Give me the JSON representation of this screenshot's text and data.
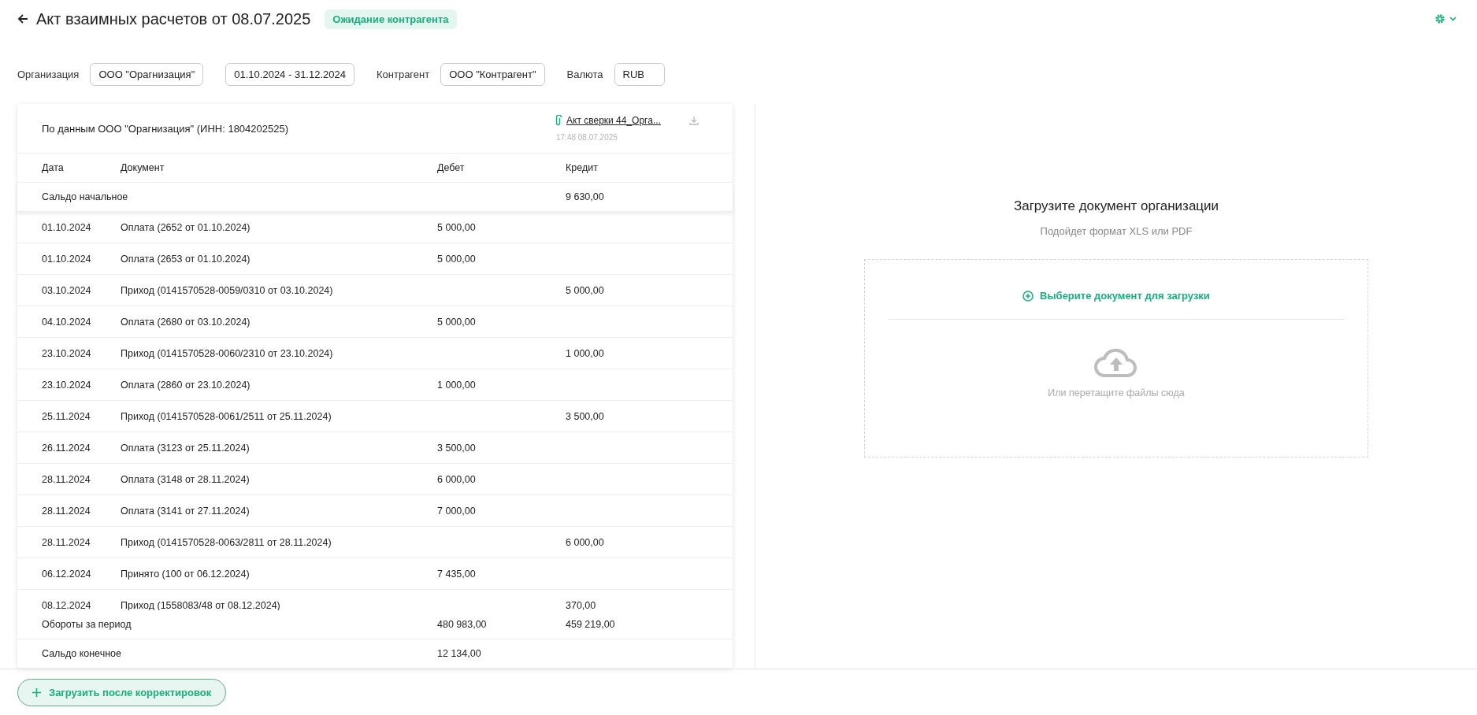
{
  "header": {
    "title": "Акт взаимных расчетов от 08.07.2025",
    "status": "Ожидание контрагента"
  },
  "filters": [
    {
      "label": "Организация",
      "value": "ООО \"Орагнизация\""
    },
    {
      "value": "01.10.2024 - 31.12.2024"
    },
    {
      "label": "Контрагент",
      "value": "ООО \"Контрагент\""
    },
    {
      "label": "Валюта",
      "value": "RUB"
    }
  ],
  "statement": {
    "title": "По данным ООО \"Орагнизация\" (ИНН: 1804202525)",
    "attachment": {
      "name": "Акт сверки 44_Орга...",
      "time": "17:48 08.07.2025"
    },
    "columns": [
      "Дата",
      "Документ",
      "Дебет",
      "Кредит"
    ],
    "opening": {
      "label": "Сальдо начальное",
      "credit": "9 630,00"
    },
    "rows": [
      {
        "date": "01.10.2024",
        "document": "Оплата (2652 от 01.10.2024)",
        "debit": "5 000,00"
      },
      {
        "date": "01.10.2024",
        "document": "Оплата (2653 от 01.10.2024)",
        "debit": "5 000,00"
      },
      {
        "date": "03.10.2024",
        "document": "Приход (0141570528-0059/0310 от 03.10.2024)",
        "credit": "5 000,00"
      },
      {
        "date": "04.10.2024",
        "document": "Оплата (2680 от 03.10.2024)",
        "debit": "5 000,00"
      },
      {
        "date": "23.10.2024",
        "document": "Приход (0141570528-0060/2310 от 23.10.2024)",
        "credit": "1 000,00"
      },
      {
        "date": "23.10.2024",
        "document": "Оплата (2860 от 23.10.2024)",
        "debit": "1 000,00"
      },
      {
        "date": "25.11.2024",
        "document": "Приход (0141570528-0061/2511 от 25.11.2024)",
        "credit": "3 500,00"
      },
      {
        "date": "26.11.2024",
        "document": "Оплата (3123 от 25.11.2024)",
        "debit": "3 500,00"
      },
      {
        "date": "28.11.2024",
        "document": "Оплата (3148 от 28.11.2024)",
        "debit": "6 000,00"
      },
      {
        "date": "28.11.2024",
        "document": "Оплата (3141 от 27.11.2024)",
        "debit": "7 000,00"
      },
      {
        "date": "28.11.2024",
        "document": "Приход (0141570528-0063/2811 от 28.11.2024)",
        "credit": "6 000,00"
      },
      {
        "date": "06.12.2024",
        "document": "Принято (100 от 06.12.2024)",
        "debit": "7 435,00"
      },
      {
        "date": "08.12.2024",
        "document": "Приход (1558083/48 от 08.12.2024)",
        "credit": "370,00"
      }
    ],
    "totals": {
      "label": "Обороты за период",
      "debit": "480 983,00",
      "credit": "459 219,00"
    },
    "closing": {
      "label": "Сальдо конечное",
      "debit": "12 134,00"
    }
  },
  "upload": {
    "title": "Загрузите документ организации",
    "hint": "Подойдет формат XLS или PDF",
    "choose": "Выберите документ для загрузки",
    "drop": "Или перетащите файлы сюда"
  },
  "footer": {
    "button": "Загрузить после корректировок"
  }
}
